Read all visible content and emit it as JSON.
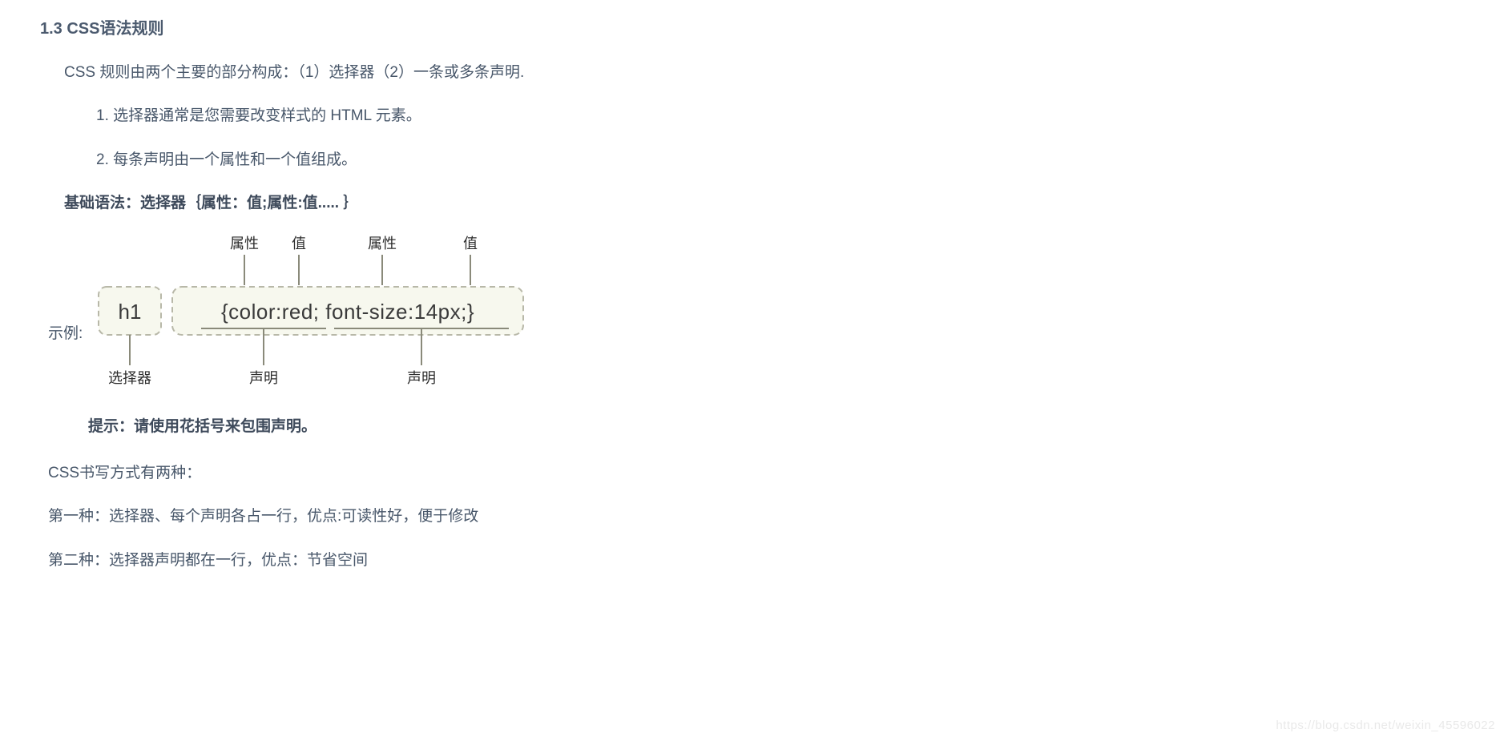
{
  "heading": "1.3 CSS语法规则",
  "intro": "CSS 规则由两个主要的部分构成：（1）选择器（2）一条或多条声明.",
  "list_item_1": "1. 选择器通常是您需要改变样式的 HTML 元素。",
  "list_item_2": "2. 每条声明由一个属性和一个值组成。",
  "syntax_line": "基础语法：选择器｛属性：值;属性:值..... ｝",
  "example_label": "示例:",
  "tip": "提示：请使用花括号来包围声明。",
  "two_ways": "CSS书写方式有两种：",
  "way1": "第一种：选择器、每个声明各占一行，优点:可读性好，便于修改",
  "way2": "第二种：选择器声明都在一行，优点：节省空间",
  "diagram": {
    "top_attr1": "属性",
    "top_val1": "值",
    "top_attr2": "属性",
    "top_val2": "值",
    "selector_box": "h1",
    "decl_text": "{color:red; font-size:14px;}",
    "bottom_selector": "选择器",
    "bottom_decl1": "声明",
    "bottom_decl2": "声明"
  },
  "watermark": "https://blog.csdn.net/weixin_45596022",
  "colors": {
    "text": "#48576a",
    "box_bg": "#f7f8ee",
    "box_border": "#b8b8a8"
  }
}
